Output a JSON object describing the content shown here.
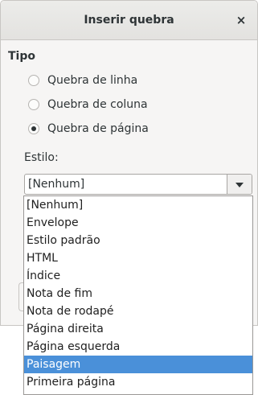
{
  "dialog": {
    "title": "Inserir quebra",
    "close_glyph": "×"
  },
  "tipo": {
    "label": "Tipo",
    "options": [
      {
        "label": "Quebra de linha",
        "checked": false
      },
      {
        "label": "Quebra de coluna",
        "checked": false
      },
      {
        "label": "Quebra de página",
        "checked": true
      }
    ]
  },
  "estilo": {
    "label": "Estilo:",
    "selected": "[Nenhum]"
  },
  "dropdown": {
    "items": [
      "[Nenhum]",
      "Envelope",
      "Estilo padrão",
      "HTML",
      "Índice",
      "Nota de fim",
      "Nota de rodapé",
      "Página direita",
      "Página esquerda",
      "Paisagem",
      "Primeira página"
    ],
    "highlighted": "Paisagem"
  }
}
